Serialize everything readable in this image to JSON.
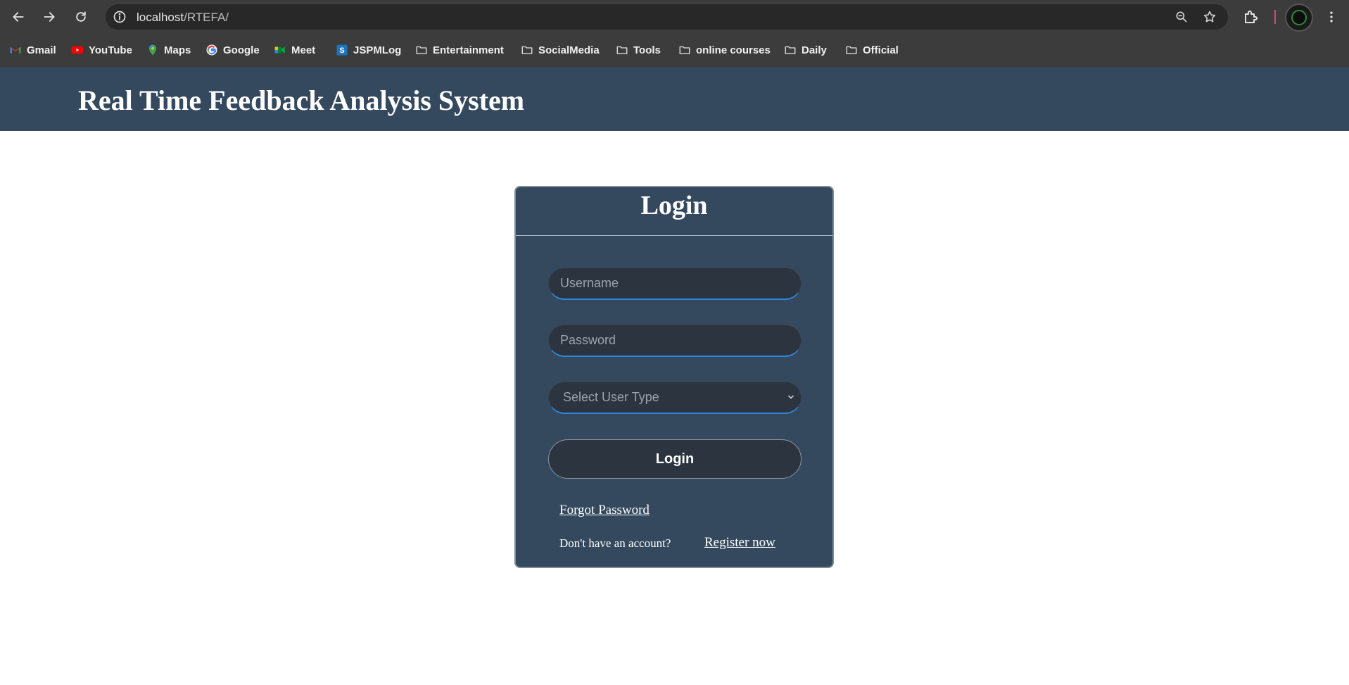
{
  "browser": {
    "url_host": "localhost",
    "url_path": "/RTEFA/",
    "bookmarks": [
      {
        "label": "Gmail",
        "icon": "gmail-icon"
      },
      {
        "label": "YouTube",
        "icon": "youtube-icon"
      },
      {
        "label": "Maps",
        "icon": "maps-icon"
      },
      {
        "label": "Google",
        "icon": "google-icon"
      },
      {
        "label": "Meet",
        "icon": "meet-icon"
      },
      {
        "label": "JSPMLog",
        "icon": "jspmlog-icon"
      },
      {
        "label": "Entertainment",
        "icon": "folder-icon"
      },
      {
        "label": "SocialMedia",
        "icon": "folder-icon"
      },
      {
        "label": "Tools",
        "icon": "folder-icon"
      },
      {
        "label": "online courses",
        "icon": "folder-icon"
      },
      {
        "label": "Daily",
        "icon": "folder-icon"
      },
      {
        "label": "Official",
        "icon": "folder-icon"
      }
    ]
  },
  "header": {
    "title": "Real Time Feedback Analysis System"
  },
  "login": {
    "title": "Login",
    "username_placeholder": "Username",
    "password_placeholder": "Password",
    "user_type_placeholder": "Select User Type",
    "submit_label": "Login",
    "forgot_password": "Forgot Password",
    "no_account_text": "Don't have an account?",
    "register_link": "Register now"
  },
  "colors": {
    "header_bg": "#34495e",
    "card_bg": "#34495e",
    "input_bg": "#2c3440",
    "input_accent": "#2e86de"
  }
}
